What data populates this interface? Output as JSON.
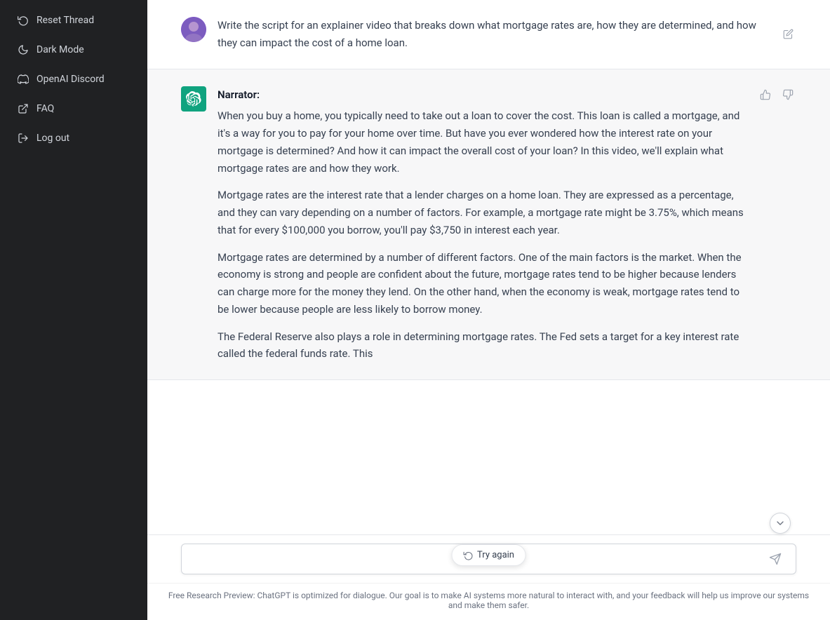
{
  "sidebar": {
    "items": [
      {
        "id": "reset-thread",
        "label": "Reset Thread",
        "icon": "reset"
      },
      {
        "id": "dark-mode",
        "label": "Dark Mode",
        "icon": "moon"
      },
      {
        "id": "openai-discord",
        "label": "OpenAI Discord",
        "icon": "discord"
      },
      {
        "id": "faq",
        "label": "FAQ",
        "icon": "external-link"
      },
      {
        "id": "log-out",
        "label": "Log out",
        "icon": "logout"
      }
    ]
  },
  "messages": [
    {
      "id": "user-1",
      "role": "user",
      "text": "Write the script for an explainer video that breaks down what mortgage rates are, how they are determined, and how they can impact the cost of a home loan."
    },
    {
      "id": "ai-1",
      "role": "ai",
      "narrator_label": "Narrator:",
      "paragraphs": [
        "When you buy a home, you typically need to take out a loan to cover the cost. This loan is called a mortgage, and it's a way for you to pay for your home over time. But have you ever wondered how the interest rate on your mortgage is determined? And how it can impact the overall cost of your loan? In this video, we'll explain what mortgage rates are and how they work.",
        "Mortgage rates are the interest rate that a lender charges on a home loan. They are expressed as a percentage, and they can vary depending on a number of factors. For example, a mortgage rate might be 3.75%, which means that for every $100,000 you borrow, you'll pay $3,750 in interest each year.",
        "Mortgage rates are determined by a number of different factors. One of the main factors is the market. When the economy is strong and people are confident about the future, mortgage rates tend to be higher because lenders can charge more for the money they lend. On the other hand, when the economy is weak, mortgage rates tend to be lower because people are less likely to borrow money.",
        "The Federal Reserve also plays a role in determining mortgage rates. The Fed sets a target for a key interest rate called the federal funds rate. This"
      ]
    }
  ],
  "input": {
    "placeholder": ""
  },
  "try_again_label": "Try again",
  "footer": {
    "text": "Free Research Preview: ChatGPT is optimized for dialogue. Our goal is to make AI systems more natural to interact with, and your feedback will help us improve our systems and make them safer."
  }
}
